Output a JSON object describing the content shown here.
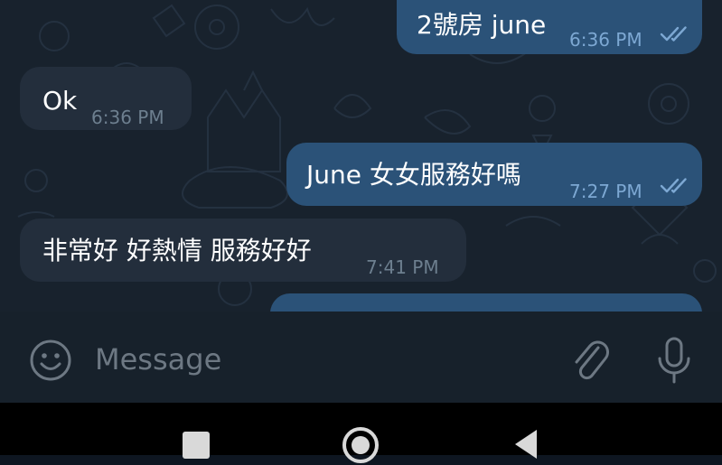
{
  "messages": [
    {
      "direction": "out",
      "lines": [
        "2號房 june"
      ],
      "time": "6:36 PM",
      "status": "read",
      "status_icon": "double-check-icon"
    },
    {
      "direction": "in",
      "lines": [
        "Ok"
      ],
      "time": "6:36 PM"
    },
    {
      "direction": "out",
      "lines": [
        "June 女女服務好嗎"
      ],
      "time": "7:27 PM",
      "status": "read",
      "status_icon": "double-check-icon"
    },
    {
      "direction": "in",
      "lines": [
        "非常好 好熱情 服務好好"
      ],
      "time": "7:41 PM"
    },
    {
      "direction": "out",
      "lines": [
        ""
      ],
      "time": ""
    }
  ],
  "input_bar": {
    "placeholder": "Message",
    "value": "",
    "emoji_icon": "emoji-icon",
    "attach_icon": "paperclip-icon",
    "mic_icon": "microphone-icon"
  },
  "nav_bar": {
    "recents_icon": "square-icon",
    "home_icon": "circle-icon",
    "back_icon": "triangle-back-icon"
  },
  "colors": {
    "chat_background": "#18222d",
    "incoming_bubble": "#232e3c",
    "outgoing_bubble": "#2b5278",
    "input_bar": "#17212b",
    "read_check": "#7da8d3"
  }
}
